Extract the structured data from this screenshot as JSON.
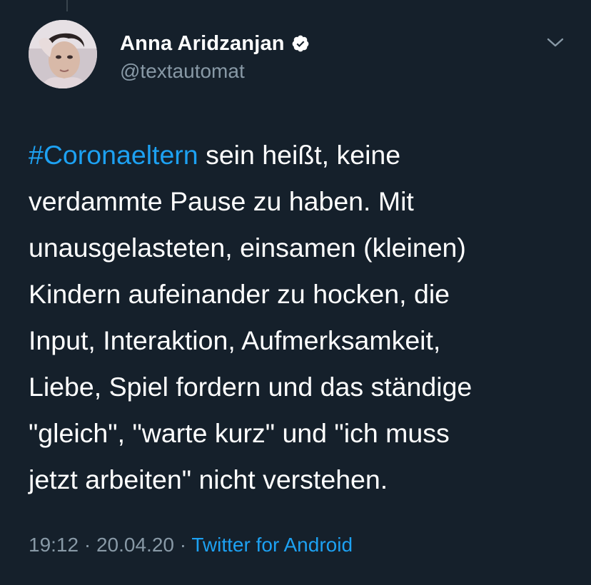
{
  "author": {
    "display_name": "Anna Aridzanjan",
    "handle": "@textautomat",
    "verified": true
  },
  "tweet": {
    "hashtag": "#Coronaeltern",
    "line1_rest": " sein heißt, keine",
    "line2": "verdammte Pause zu haben. Mit",
    "line3": "unausgelasteten, einsamen (kleinen)",
    "line4": "Kindern aufeinander zu hocken, die",
    "line5": "Input, Interaktion, Aufmerksamkeit,",
    "line6": "Liebe, Spiel fordern und das ständige",
    "line7": "\"gleich\", \"warte kurz\" und \"ich muss",
    "line8": "jetzt arbeiten\" nicht verstehen."
  },
  "meta": {
    "time": "19:12",
    "separator1": " · ",
    "date": "20.04.20",
    "separator2": " · ",
    "source": "Twitter for Android"
  },
  "icons": {
    "verified": "verified-badge-icon",
    "menu": "chevron-down-icon"
  },
  "colors": {
    "background": "#15202b",
    "accent": "#1da1f2",
    "secondary_text": "#8899a6",
    "primary_text": "#ffffff"
  }
}
